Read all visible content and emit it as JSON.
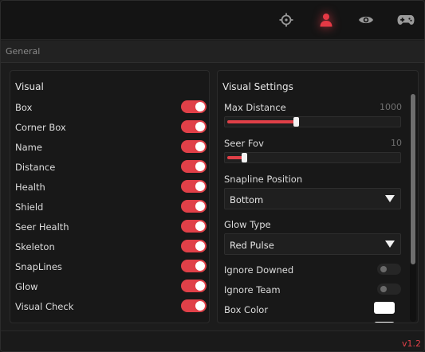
{
  "tabs": [
    {
      "icon": "crosshair-icon",
      "active": false
    },
    {
      "icon": "user-icon",
      "active": true
    },
    {
      "icon": "eye-icon",
      "active": false
    },
    {
      "icon": "gamepad-icon",
      "active": false
    }
  ],
  "section": {
    "title": "General"
  },
  "visual": {
    "title": "Visual",
    "items": [
      {
        "label": "Box",
        "on": true
      },
      {
        "label": "Corner Box",
        "on": true
      },
      {
        "label": "Name",
        "on": true
      },
      {
        "label": "Distance",
        "on": true
      },
      {
        "label": "Health",
        "on": true
      },
      {
        "label": "Shield",
        "on": true
      },
      {
        "label": "Seer Health",
        "on": true
      },
      {
        "label": "Skeleton",
        "on": true
      },
      {
        "label": "SnapLines",
        "on": true
      },
      {
        "label": "Glow",
        "on": true
      },
      {
        "label": "Visual Check",
        "on": true
      }
    ]
  },
  "visual_settings": {
    "title": "Visual Settings",
    "max_distance": {
      "label": "Max Distance",
      "value": "1000",
      "fraction": 0.4
    },
    "seer_fov": {
      "label": "Seer Fov",
      "value": "10",
      "fraction": 0.1
    },
    "snapline_position": {
      "label": "Snapline Position",
      "selected": "Bottom"
    },
    "glow_type": {
      "label": "Glow Type",
      "selected": "Red Pulse"
    },
    "ignore_downed": {
      "label": "Ignore Downed",
      "on": false
    },
    "ignore_team": {
      "label": "Ignore Team",
      "on": false
    },
    "box_color": {
      "label": "Box Color",
      "color": "#ffffff"
    }
  },
  "footer": {
    "version": "v1.2"
  },
  "colors": {
    "accent": "#e04048",
    "background": "#1c1c1c",
    "panel": "#181818"
  }
}
